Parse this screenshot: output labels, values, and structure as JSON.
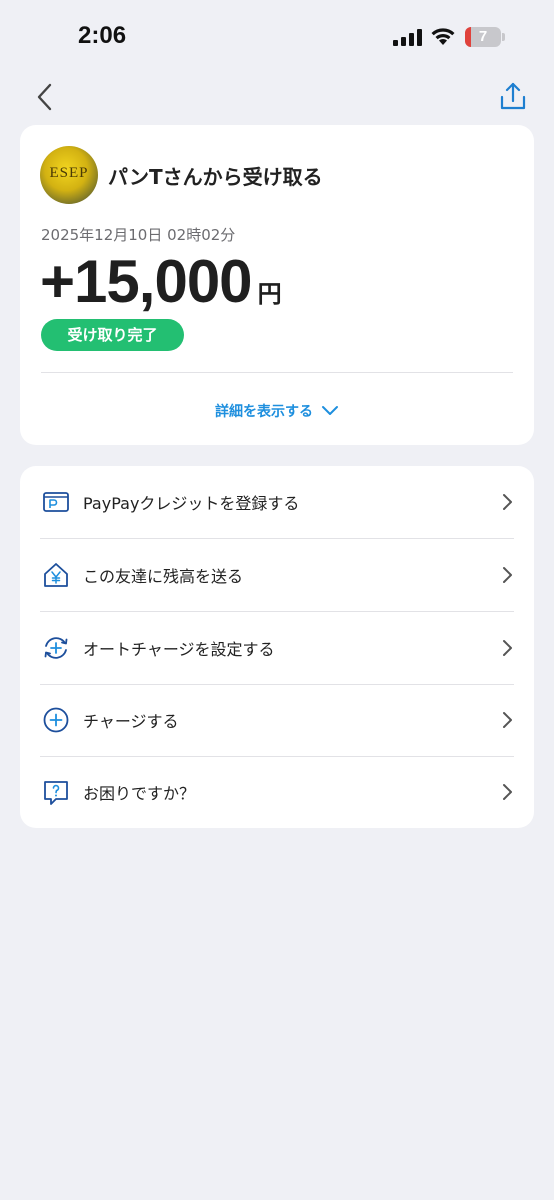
{
  "status_bar": {
    "time": "2:06",
    "battery_level": "7"
  },
  "nav": {
    "back_icon": "chevron-left-icon",
    "share_icon": "share-icon"
  },
  "transaction": {
    "avatar_text": "ESEP",
    "title": "パンTさんから受け取る",
    "datetime": "2025年12月10日 02時02分",
    "amount": "+15,000",
    "currency": "円",
    "status": "受け取り完了",
    "details_label": "詳細を表示する"
  },
  "actions": [
    {
      "icon": "paypay-credit-card-icon",
      "label": "PayPayクレジットを登録する"
    },
    {
      "icon": "house-yen-icon",
      "label": "この友達に残高を送る"
    },
    {
      "icon": "auto-charge-icon",
      "label": "オートチャージを設定する"
    },
    {
      "icon": "plus-circle-icon",
      "label": "チャージする"
    },
    {
      "icon": "help-bubble-icon",
      "label": "お困りですか？"
    }
  ],
  "colors": {
    "accent": "#1e8fde",
    "status_green": "#23bf72",
    "background": "#eff0f5",
    "icon_blue": "#1d4f9c"
  }
}
